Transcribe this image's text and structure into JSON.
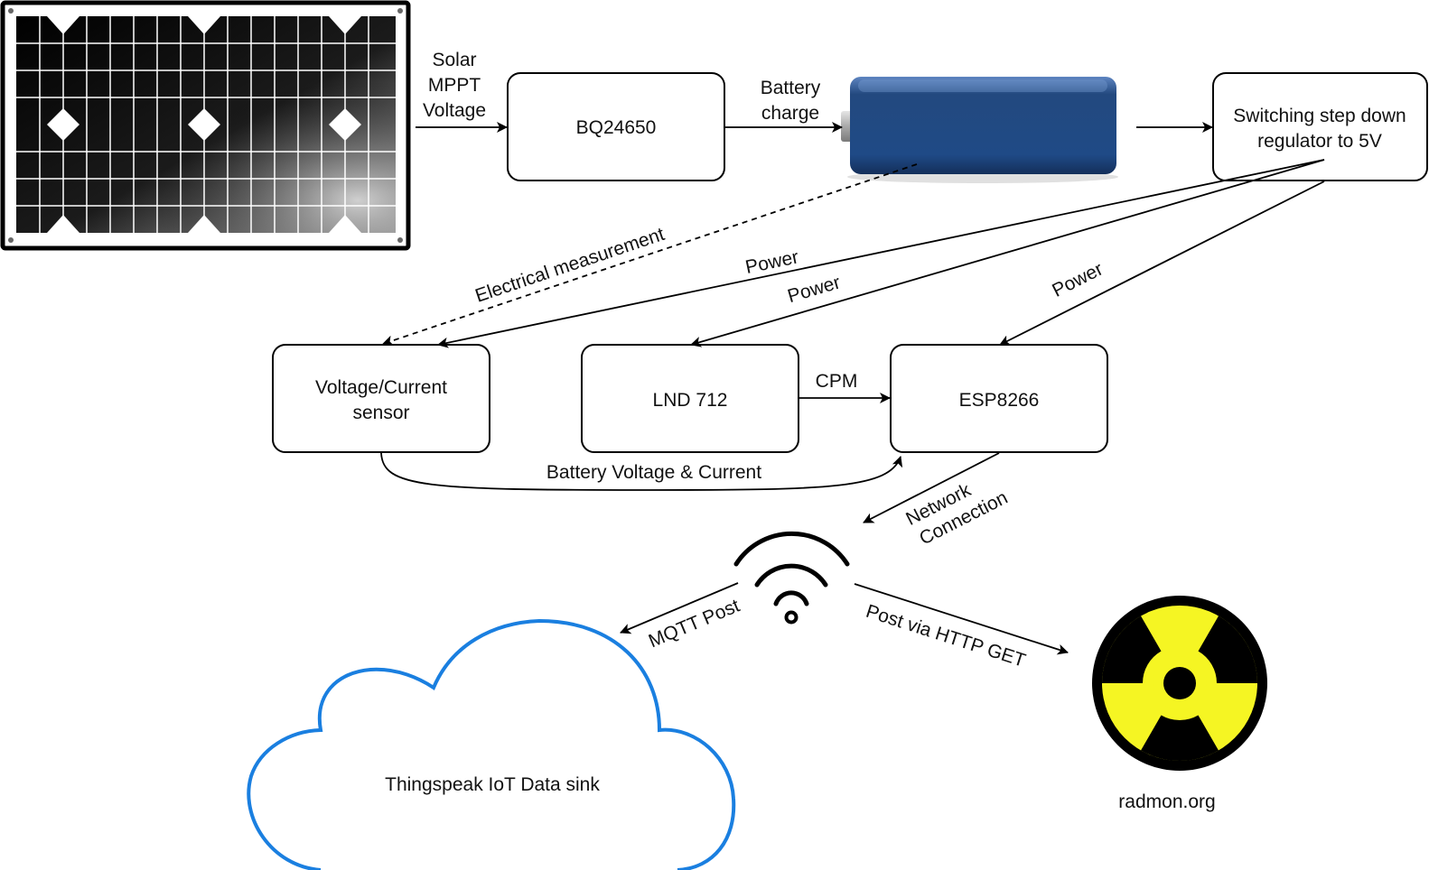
{
  "nodes": {
    "solar_panel": {
      "icon": "solar-panel-icon"
    },
    "bq24650": {
      "label": "BQ24650"
    },
    "battery": {
      "icon": "battery-icon",
      "colors": {
        "body": "#23497f",
        "light": "#5e85c1"
      }
    },
    "regulator": {
      "label_line1": "Switching step down",
      "label_line2": "regulator to 5V"
    },
    "vc_sensor": {
      "label_line1": "Voltage/Current",
      "label_line2": "sensor"
    },
    "lnd712": {
      "label": "LND 712"
    },
    "esp8266": {
      "label": "ESP8266"
    },
    "wifi": {
      "icon": "wifi-icon"
    },
    "cloud": {
      "label": "Thingspeak IoT Data sink",
      "color": "#1a7fe0"
    },
    "radmon": {
      "label": "radmon.org",
      "icon": "radiation-icon",
      "color": "#f5f523"
    }
  },
  "edges": {
    "solar_mppt": {
      "line1": "Solar",
      "line2": "MPPT",
      "line3": "Voltage"
    },
    "battery_charge": {
      "line1": "Battery",
      "line2": "charge"
    },
    "electrical_measurement": "Electrical measurement",
    "power_1": "Power",
    "power_2": "Power",
    "power_3": "Power",
    "cpm": "CPM",
    "battery_voltage_current": "Battery Voltage & Current",
    "network_connection": {
      "line1": "Network",
      "line2": "Connection"
    },
    "mqtt_post": "MQTT Post",
    "http_get": "Post via HTTP GET"
  }
}
